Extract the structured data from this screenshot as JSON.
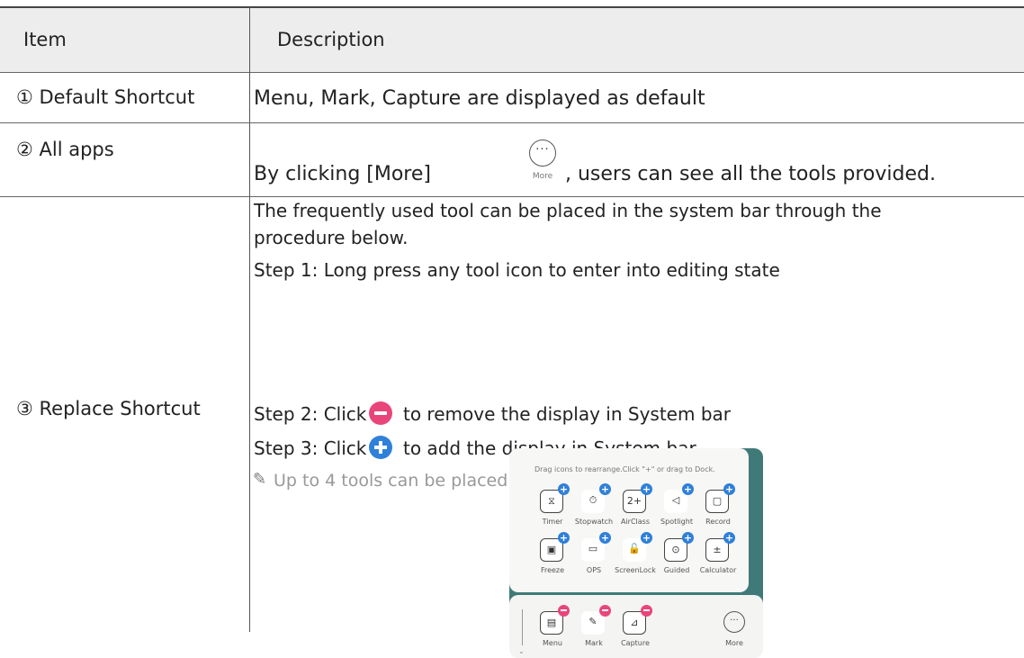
{
  "table": {
    "header": {
      "col1": "Item",
      "col2": "Description"
    },
    "rows": [
      {
        "item": "① Default Shortcut",
        "desc": "Menu, Mark, Capture are displayed as default"
      },
      {
        "item": "② All apps",
        "desc_pre": "By clicking [More]",
        "desc_post": ", users can see all the tools provided."
      },
      {
        "item": "③ Replace Shortcut",
        "lines": [
          "The frequently used tool can be placed in the system bar through the",
          "procedure below.",
          "Step 1: Long press any tool icon to enter into editing state"
        ],
        "step2_pre": "Step 2: Click",
        "step2_post": "to remove the display in System bar",
        "step3_pre": "Step 3: Click",
        "step3_post": "to add the display in System bar",
        "note": "Up to 4 tools can be placed."
      }
    ]
  },
  "more_icon": {
    "glyph": "···",
    "label": "More"
  },
  "panel": {
    "hint": "Drag icons to rearrange.Click \"+\" or drag to Dock.",
    "tools_row1": [
      {
        "label": "Timer",
        "glyph": "⧖"
      },
      {
        "label": "Stopwatch",
        "glyph": "⏱"
      },
      {
        "label": "AirClass",
        "glyph": "2+"
      },
      {
        "label": "Spotlight",
        "glyph": "◁"
      },
      {
        "label": "Record",
        "glyph": "▢"
      }
    ],
    "tools_row2": [
      {
        "label": "Freeze",
        "glyph": "▣"
      },
      {
        "label": "OPS",
        "glyph": "▭"
      },
      {
        "label": "ScreenLock",
        "glyph": "🔓"
      },
      {
        "label": "Guided",
        "glyph": "⊙"
      },
      {
        "label": "Calculator",
        "glyph": "±"
      }
    ],
    "dock": [
      {
        "label": "Menu",
        "glyph": "▤"
      },
      {
        "label": "Mark",
        "glyph": "✎"
      },
      {
        "label": "Capture",
        "glyph": "⊿"
      }
    ],
    "dock_more": {
      "label": "More",
      "glyph": "···"
    },
    "colors": {
      "add": "#2f80d9",
      "remove": "#e8467a",
      "bg": "#3f7a78"
    }
  }
}
